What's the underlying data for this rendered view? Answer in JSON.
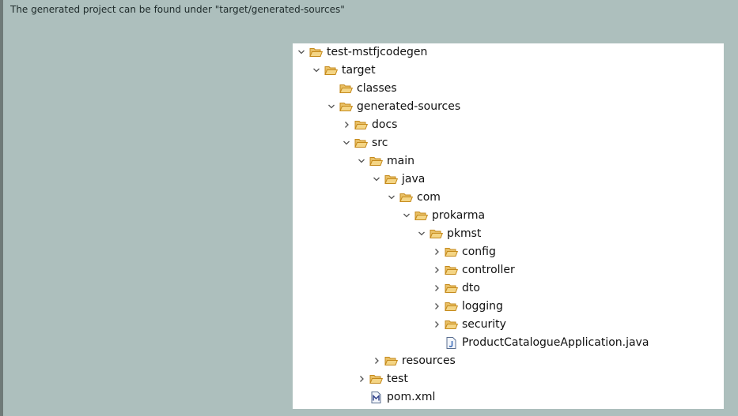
{
  "caption": "The generated project can be found under \"target/generated-sources\"",
  "colors": {
    "background": "#adbfbd",
    "panel": "#ffffff",
    "folder_fill": "#f4d585",
    "folder_stroke": "#c58a1b",
    "chevron": "#555555"
  },
  "tree": [
    {
      "label": "test-mstfjcodegen",
      "depth": 0,
      "state": "expanded",
      "icon": "folder-open-icon"
    },
    {
      "label": "target",
      "depth": 1,
      "state": "expanded",
      "icon": "folder-open-icon"
    },
    {
      "label": "classes",
      "depth": 2,
      "state": "leaf",
      "icon": "folder-open-icon"
    },
    {
      "label": "generated-sources",
      "depth": 2,
      "state": "expanded",
      "icon": "folder-open-icon"
    },
    {
      "label": "docs",
      "depth": 3,
      "state": "collapsed",
      "icon": "folder-open-icon"
    },
    {
      "label": "src",
      "depth": 3,
      "state": "expanded",
      "icon": "folder-open-icon"
    },
    {
      "label": "main",
      "depth": 4,
      "state": "expanded",
      "icon": "folder-open-icon"
    },
    {
      "label": "java",
      "depth": 5,
      "state": "expanded",
      "icon": "folder-open-icon"
    },
    {
      "label": "com",
      "depth": 6,
      "state": "expanded",
      "icon": "folder-open-icon"
    },
    {
      "label": "prokarma",
      "depth": 7,
      "state": "expanded",
      "icon": "folder-open-icon"
    },
    {
      "label": "pkmst",
      "depth": 8,
      "state": "expanded",
      "icon": "folder-open-icon"
    },
    {
      "label": "config",
      "depth": 9,
      "state": "collapsed",
      "icon": "folder-open-icon"
    },
    {
      "label": "controller",
      "depth": 9,
      "state": "collapsed",
      "icon": "folder-open-icon"
    },
    {
      "label": "dto",
      "depth": 9,
      "state": "collapsed",
      "icon": "folder-open-icon"
    },
    {
      "label": "logging",
      "depth": 9,
      "state": "collapsed",
      "icon": "folder-open-icon"
    },
    {
      "label": "security",
      "depth": 9,
      "state": "collapsed",
      "icon": "folder-open-icon"
    },
    {
      "label": "ProductCatalogueApplication.java",
      "depth": 9,
      "state": "leaf",
      "icon": "java-file-icon"
    },
    {
      "label": "resources",
      "depth": 5,
      "state": "collapsed",
      "icon": "folder-open-icon"
    },
    {
      "label": "test",
      "depth": 4,
      "state": "collapsed",
      "icon": "folder-open-icon"
    },
    {
      "label": "pom.xml",
      "depth": 4,
      "state": "leaf",
      "icon": "maven-pom-icon"
    }
  ]
}
